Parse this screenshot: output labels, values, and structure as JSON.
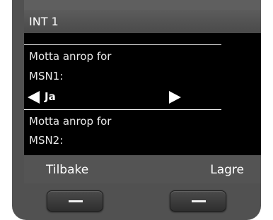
{
  "header": {
    "title": "INT 1"
  },
  "settings": [
    {
      "label_line1": "Motta anrop for",
      "label_line2": "MSN1:",
      "value": "Ja"
    },
    {
      "label_line1": "Motta anrop for",
      "label_line2": "MSN2:"
    }
  ],
  "softkeys": {
    "left": "Tilbake",
    "right": "Lagre"
  },
  "icons": {
    "left_arrow": "triangle-left-icon",
    "right_arrow": "triangle-right-icon",
    "scroll": "triangle-down-icon"
  },
  "colors": {
    "screen_bg": "#000000",
    "bezel": "#515151",
    "text": "#ffffff"
  }
}
